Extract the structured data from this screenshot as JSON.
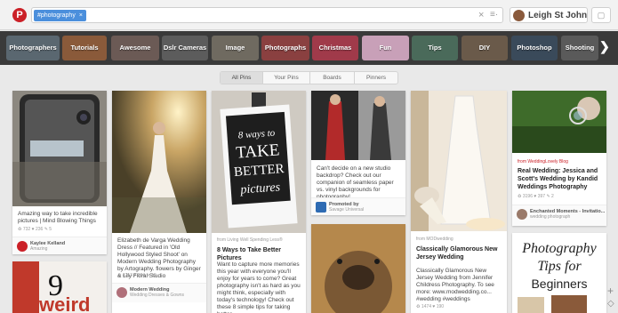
{
  "search": {
    "tag": "#photography",
    "tag_remove": "×",
    "clear": "×",
    "menu": "≡·"
  },
  "user": {
    "name": "Leigh St John",
    "messages": "▢"
  },
  "categories": [
    {
      "label": "Photographers",
      "color": "#5a6770"
    },
    {
      "label": "Tutorials",
      "color": "#8a5a3a"
    },
    {
      "label": "Awesome",
      "color": "#6b5a55"
    },
    {
      "label": "Dslr Cameras",
      "color": "#5c5c5c"
    },
    {
      "label": "Image",
      "color": "#6f6a60"
    },
    {
      "label": "Photographs",
      "color": "#8a4040"
    },
    {
      "label": "Christmas",
      "color": "#a03a4a"
    },
    {
      "label": "Fun",
      "color": "#c8a0b8"
    },
    {
      "label": "Tips",
      "color": "#4a6a5a"
    },
    {
      "label": "DIY",
      "color": "#6a5a4a"
    },
    {
      "label": "Photoshop",
      "color": "#3a4a5a"
    },
    {
      "label": "Shooting",
      "color": "#5a5a5a"
    }
  ],
  "cat_next": "❯",
  "filters": [
    "All Pins",
    "Your Pins",
    "Boards",
    "Pinners"
  ],
  "pins": {
    "p1": {
      "desc": "Amazing way to take incredible pictures | Mind Blowing Things",
      "stats": "♻ 732  ♥ 236  ✎ 5",
      "pinner": "Kaylee Kelland",
      "board": "Amazing"
    },
    "p1b": {
      "big": "9",
      "word": "weird"
    },
    "p2": {
      "desc": "Elizabeth de Varga Wedding Dress // Featured in 'Old Hollywood Styled Shoot' on Modern Wedding Photography by Artography. flowers by Ginger & Lily Floral Studio",
      "stats": "♻ 4213  ♥ 984  ✎ 13",
      "pinner": "Modern Wedding",
      "board": "Wedding Dresses & Gowns"
    },
    "p3": {
      "overlay_1": "8 ways to",
      "overlay_2": "TAKE",
      "overlay_3": "BETTER",
      "overlay_4": "pictures",
      "via": "from Living Well Spending Less®",
      "title": "8 Ways to Take Better Pictures",
      "desc": "Want to capture more memories this year with everyone you'll enjoy for years to come? Great photography isn't as hard as you might think, especially with today's technology! Check out these 8 simple tips for taking better"
    },
    "p4": {
      "desc": "Can't decide on a new studio backdrop? Check out our companion of seamless paper vs. vinyl backgrounds for photography!",
      "promoted": "Promoted by",
      "promoter": "Savage Universal"
    },
    "p5": {
      "via": "from MODwedding",
      "title": "Classically Glamorous New Jersey Wedding",
      "desc": "Classically Glamorous New Jersey Wedding from Jennifer Childress Photography. To see more: www.modwedding.co... #wedding #weddings",
      "stats": "♻ 1474  ♥ 190"
    },
    "p6": {
      "via": "from WeddingLovely Blog",
      "title": "Real Wedding: Jessica and Scott's Wedding by Kandid Weddings Photography",
      "stats": "♻ 3196  ♥ 397  ✎ 2",
      "pinner": "Enchanted Moments - Invitatio...",
      "board": "wedding photograph"
    },
    "p7": {
      "line1": "Photography",
      "line2": "Tips for",
      "line3": "Beginners"
    }
  },
  "side": {
    "plus": "+",
    "arrow": "◇"
  }
}
